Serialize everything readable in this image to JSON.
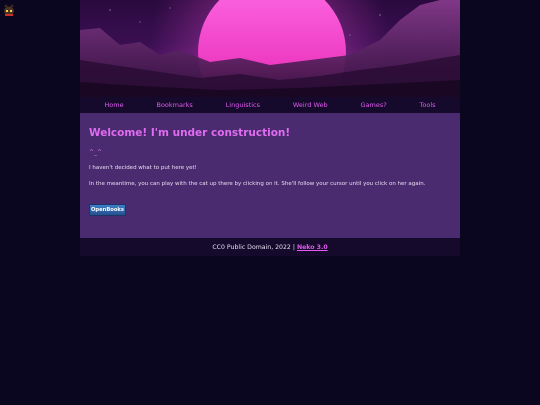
{
  "nav": {
    "items": [
      {
        "label": "Home"
      },
      {
        "label": "Bookmarks"
      },
      {
        "label": "Linguistics"
      },
      {
        "label": "Weird Web"
      },
      {
        "label": "Games?"
      },
      {
        "label": "Tools"
      }
    ]
  },
  "main": {
    "heading": "Welcome! I'm under construction!",
    "emote": "^_^",
    "paragraph1": "I haven't decided what to put here yet!",
    "paragraph2": "In the meantime, you can play with the cat up there by clicking on it. She'll follow your cursor until you click on her again.",
    "badge_label": "OpenBooks"
  },
  "footer": {
    "text": "CC0 Public Domain, 2022 |",
    "link_label": "Neko 3.0"
  },
  "colors": {
    "page_background": "#0b0620",
    "content_background": "#4b2b6f",
    "nav_background": "#150a2b",
    "accent": "#e15bf0",
    "sun": "#ff3ad0"
  }
}
